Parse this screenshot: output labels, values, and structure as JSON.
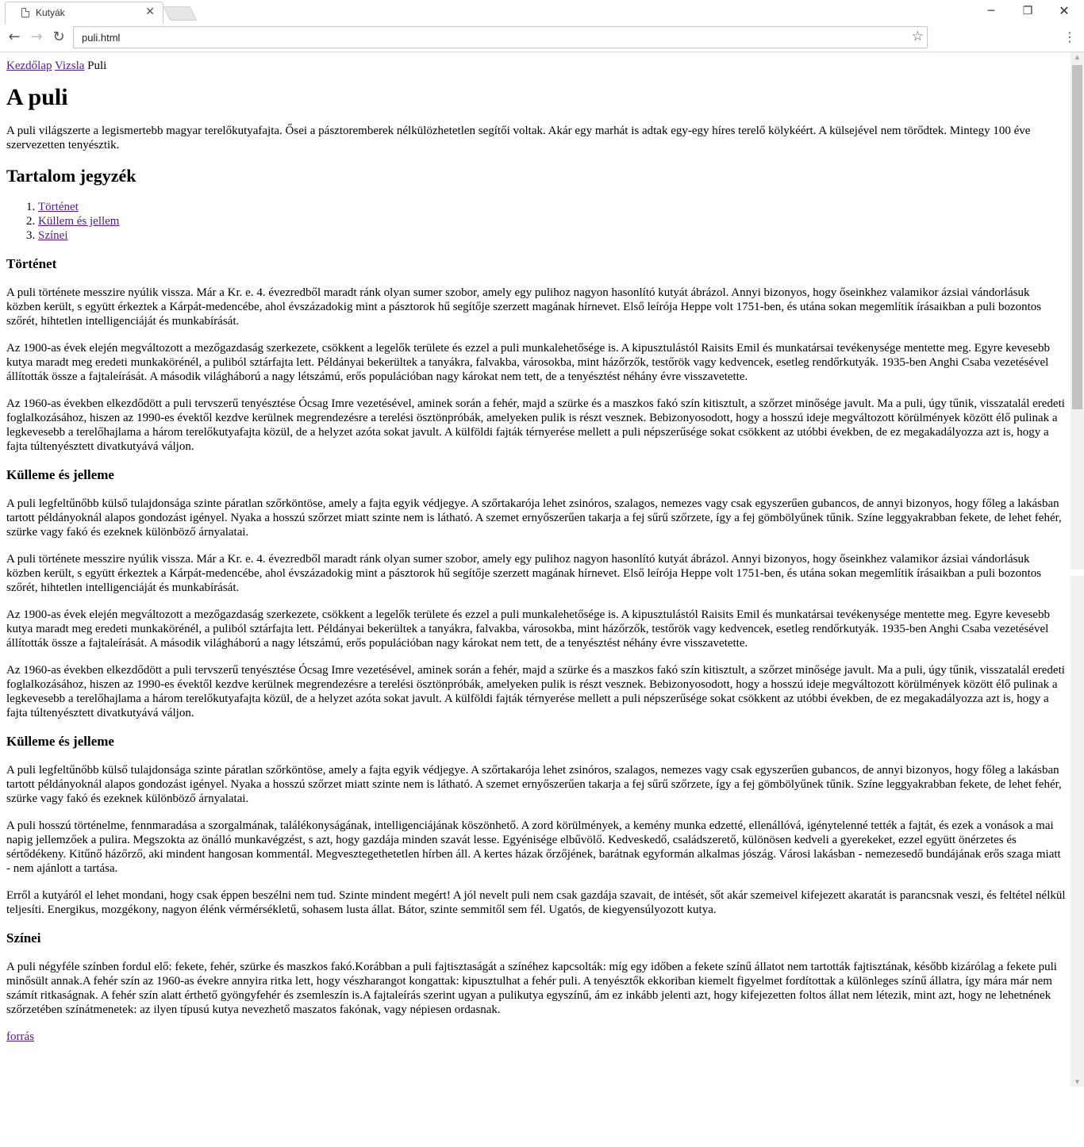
{
  "browser": {
    "tab_title": "Kutyák",
    "url": "puli.html"
  },
  "breadcrumb": {
    "items": [
      "Kezdőlap",
      "Vizsla"
    ],
    "current": "Puli"
  },
  "page": {
    "title": "A puli",
    "intro": "A puli világszerte a legismertebb magyar terelőkutyafajta. Ősei a pásztoremberek nélkülözhetetlen segítői voltak. Akár egy marhát is adtak egy-egy híres terelő kölykéért. A külsejével nem törődtek. Mintegy 100 éve szervezetten tenyésztik.",
    "toc_title": "Tartalom jegyzék",
    "toc": [
      "Történet",
      "Küllem és jellem",
      "Színei"
    ],
    "sections": [
      {
        "title": "Történet",
        "paragraphs": [
          "A puli története messzire nyúlik vissza. Már a Kr. e. 4. évezredből maradt ránk olyan sumer szobor, amely egy pulihoz nagyon hasonlító kutyát ábrázol. Annyi bizonyos, hogy őseinkhez valamikor ázsiai vándorlásuk közben került, s együtt érkeztek a Kárpát-medencébe, ahol évszázadokig mint a pásztorok hű segítője szerzett magának hírnevet. Első leírója Heppe volt 1751-ben, és utána sokan megemlítik írásaikban a puli bozontos szőrét, hihtetlen intelligenciáját és munkabírását.",
          "Az 1900-as évek elején megváltozott a mezőgazdaság szerkezete, csökkent a legelők területe és ezzel a puli munkalehetősége is. A kipusztulástól Raisits Emil és munkatársai tevékenysége mentette meg. Egyre kevesebb kutya maradt meg eredeti munkakörénél, a puliból sztárfajta lett. Példányai bekerültek a tanyákra, falvakba, városokba, mint házőrzők, testőrök vagy kedvencek, esetleg rendőrkutyák. 1935-ben Anghi Csaba vezetésével állították össze a fajtaleírását. A második világháború a nagy létszámú, erős populációban nagy károkat nem tett, de a tenyésztést néhány évre visszavetette.",
          "Az 1960-as években elkezdődött a puli tervszerű tenyésztése Ócsag Imre vezetésével, aminek során a fehér, majd a szürke és a maszkos fakó szín kitisztult, a szőrzet minősége javult. Ma a puli, úgy tűnik, visszatalál eredeti foglalkozásához, hiszen az 1990-es évektől kezdve kerülnek megrendezésre a terelési ösztönpróbák, amelyeken pulik is részt vesznek. Bebizonyosodott, hogy a hosszú ideje megváltozott körülmények között élő pulinak a legkevesebb a terelőhajlama a három terelőkutyafajta közül, de a helyzet azóta sokat javult. A külföldi fajták térnyerése mellett a puli népszerűsége sokat csökkent az utóbbi években, de ez megakadályozza azt is, hogy a fajta túltenyésztett divatkutyává váljon."
        ]
      },
      {
        "title": "Külleme és jelleme",
        "paragraphs": [
          "A puli legfeltűnőbb külső tulajdonsága szinte páratlan szőrköntöse, amely a fajta egyik védjegye. A szőrtakarója lehet zsinóros, szalagos, nemezes vagy csak egyszerűen gubancos, de annyi bizonyos, hogy főleg a lakásban tartott példányoknál alapos gondozást igényel. Nyaka a hosszú szőrzet miatt szinte nem is látható. A szemet ernyőszerűen takarja a fej sűrű szőrzete, így a fej gömbölyűnek tűnik. Színe leggyakrabban fekete, de lehet fehér, szürke vagy fakó és ezeknek különböző árnyalatai.",
          "A puli története messzire nyúlik vissza. Már a Kr. e. 4. évezredből maradt ránk olyan sumer szobor, amely egy pulihoz nagyon hasonlító kutyát ábrázol. Annyi bizonyos, hogy őseinkhez valamikor ázsiai vándorlásuk közben került, s együtt érkeztek a Kárpát-medencébe, ahol évszázadokig mint a pásztorok hű segítője szerzett magának hírnevet. Első leírója Heppe volt 1751-ben, és utána sokan megemlítik írásaikban a puli bozontos szőrét, hihtetlen intelligenciáját és munkabírását.",
          "Az 1900-as évek elején megváltozott a mezőgazdaság szerkezete, csökkent a legelők területe és ezzel a puli munkalehetősége is. A kipusztulástól Raisits Emil és munkatársai tevékenysége mentette meg. Egyre kevesebb kutya maradt meg eredeti munkakörénél, a puliból sztárfajta lett. Példányai bekerültek a tanyákra, falvakba, városokba, mint házőrzők, testőrök vagy kedvencek, esetleg rendőrkutyák. 1935-ben Anghi Csaba vezetésével állították össze a fajtaleírását. A második világháború a nagy létszámú, erős populációban nagy károkat nem tett, de a tenyésztést néhány évre visszavetette.",
          "Az 1960-as években elkezdődött a puli tervszerű tenyésztése Ócsag Imre vezetésével, aminek során a fehér, majd a szürke és a maszkos fakó szín kitisztult, a szőrzet minősége javult. Ma a puli, úgy tűnik, visszatalál eredeti foglalkozásához, hiszen az 1990-es évektől kezdve kerülnek megrendezésre a terelési ösztönpróbák, amelyeken pulik is részt vesznek. Bebizonyosodott, hogy a hosszú ideje megváltozott körülmények között élő pulinak a legkevesebb a terelőhajlama a három terelőkutyafajta közül, de a helyzet azóta sokat javult. A külföldi fajták térnyerése mellett a puli népszerűsége sokat csökkent az utóbbi években, de ez megakadályozza azt is, hogy a fajta túltenyésztett divatkutyává váljon."
        ]
      },
      {
        "title": "Külleme és jelleme",
        "paragraphs": [
          "A puli legfeltűnőbb külső tulajdonsága szinte páratlan szőrköntöse, amely a fajta egyik védjegye. A szőrtakarója lehet zsinóros, szalagos, nemezes vagy csak egyszerűen gubancos, de annyi bizonyos, hogy főleg a lakásban tartott példányoknál alapos gondozást igényel. Nyaka a hosszú szőrzet miatt szinte nem is látható. A szemet ernyőszerűen takarja a fej sűrű szőrzete, így a fej gömbölyűnek tűnik. Színe leggyakrabban fekete, de lehet fehér, szürke vagy fakó és ezeknek különböző árnyalatai.",
          "A puli hosszú történelme, fennmaradása a szorgalmának, találékonyságának, intelligenciájának köszönhető. A zord körülmények, a kemény munka edzetté, ellenállóvá, igénytelenné tették a fajtát, és ezek a vonások a mai napig jellemzőek a pulira. Megszokta az önálló munkavégzést, s azt, hogy gazdája minden szavát lesse. Egyénisége elbűvölő. Kedveskedő, családszerető, különösen kedveli a gyerekeket, ezzel együtt önérzetes és sértődékeny. Kitűnő házőrző, aki mindent hangosan kommentál. Megvesztegethetetlen hírben áll. A kertes házak őrzőjének, barátnak egyformán alkalmas jószág. Városi lakásban - nemezesedő bundájának erős szaga miatt - nem ajánlott a tartása.",
          "Erről a kutyáról el lehet mondani, hogy csak éppen beszélni nem tud. Szinte mindent megért! A jól nevelt puli nem csak gazdája szavait, de intését, sőt akár szemeivel kifejezett akaratát is parancsnak veszi, és feltétel nélkül teljesíti. Energikus, mozgékony, nagyon élénk vérmérsékletű, sohasem lusta állat. Bátor, szinte semmitől sem fél. Ugatós, de kiegyensúlyozott kutya."
        ]
      },
      {
        "title": "Színei",
        "paragraphs": [
          "A puli négyféle színben fordul elő: fekete, fehér, szürke és maszkos fakó.Korábban a puli fajtisztaságát a színéhez kapcsolták: míg egy időben a fekete színű állatot nem tartották fajtisztának, később kizárólag a fekete puli minősült annak.A fehér szín az 1960-as évekre annyira ritka lett, hogy vészharangot kongattak: kipusztulhat a fehér puli. A tenyésztők ekkoriban kiemelt figyelmet fordítottak a különleges színű állatra, így mára már nem számít ritkaságnak. A fehér szín alatt érthető gyöngyfehér és zsemleszín is.A fajtaleírás szerint ugyan a pulikutya egyszínű, ám ez inkább jelenti azt, hogy kifejezetten foltos állat nem létezik, mint azt, hogy ne lehetnének szőrzetében színátmenetek: az ilyen típusú kutya nevezhető maszatos fakónak, vagy népiesen ordasnak."
        ]
      }
    ],
    "source_link": "forrás"
  }
}
